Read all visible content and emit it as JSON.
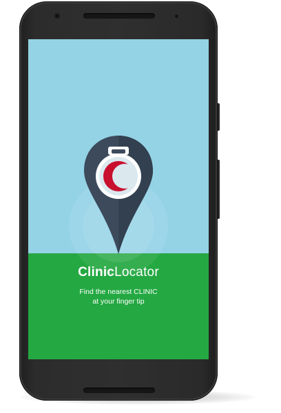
{
  "splash": {
    "title_bold": "Clinic",
    "title_light": "Locator",
    "tagline_line1": "Find the nearest CLINIC",
    "tagline_line2": "at your finger tip"
  },
  "icons": {
    "logo": "map-pin-crescent-icon"
  },
  "colors": {
    "sky": "#94d3e6",
    "ground": "#24a842",
    "pin": "#3c4a5c",
    "crescent": "#c8102e",
    "text": "#ffffff"
  }
}
